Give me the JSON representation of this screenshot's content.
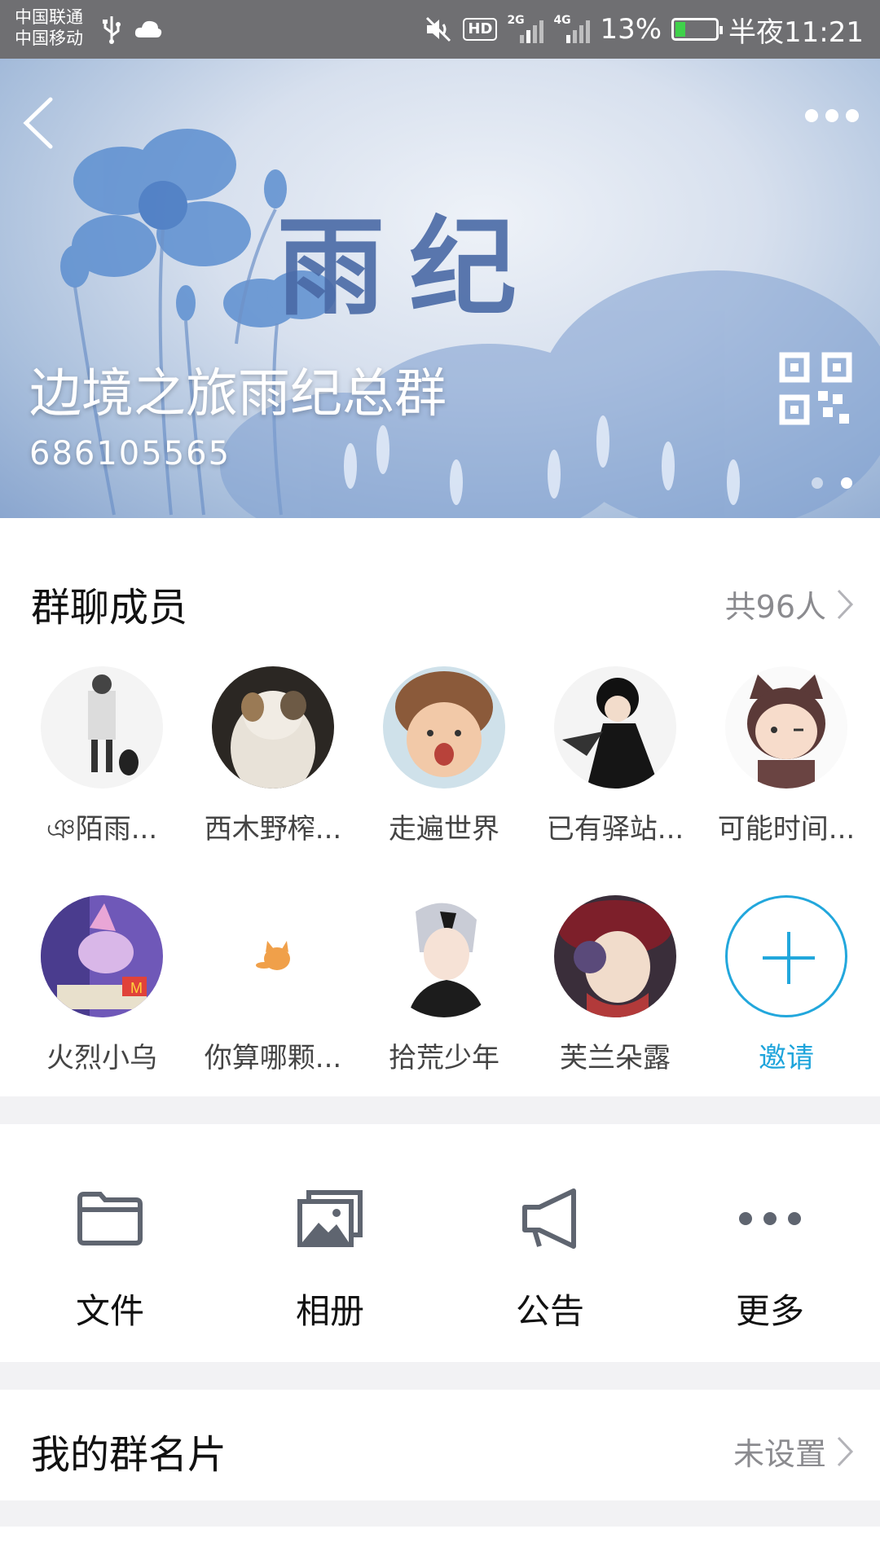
{
  "status_bar": {
    "carrier_1": "中国联通",
    "carrier_2": "中国移动",
    "net_2g": "2G",
    "net_4g": "4G",
    "hd_badge": "HD",
    "battery_percent": "13%",
    "time": "半夜11:21"
  },
  "banner": {
    "art_title": "雨纪",
    "group_name": "边境之旅雨纪总群",
    "group_id": "686105565",
    "carousel_active_index": 1
  },
  "members": {
    "title": "群聊成员",
    "count_label": "共96人",
    "list": [
      {
        "name": "ঞ陌雨..."
      },
      {
        "name": "西木野榨..."
      },
      {
        "name": "走遍世界"
      },
      {
        "name": "已有驿站..."
      },
      {
        "name": "可能时间..."
      },
      {
        "name": "火烈小乌"
      },
      {
        "name": "你算哪颗..."
      },
      {
        "name": "拾荒少年"
      },
      {
        "name": "芙兰朵露"
      }
    ],
    "invite_label": "邀请"
  },
  "tools": {
    "files": "文件",
    "album": "相册",
    "notice": "公告",
    "more": "更多"
  },
  "card": {
    "title": "我的群名片",
    "value": "未设置"
  },
  "colors": {
    "accent": "#1ea4db",
    "status_bar": "#6f6f72",
    "secondary_text": "#8b8b8f"
  }
}
